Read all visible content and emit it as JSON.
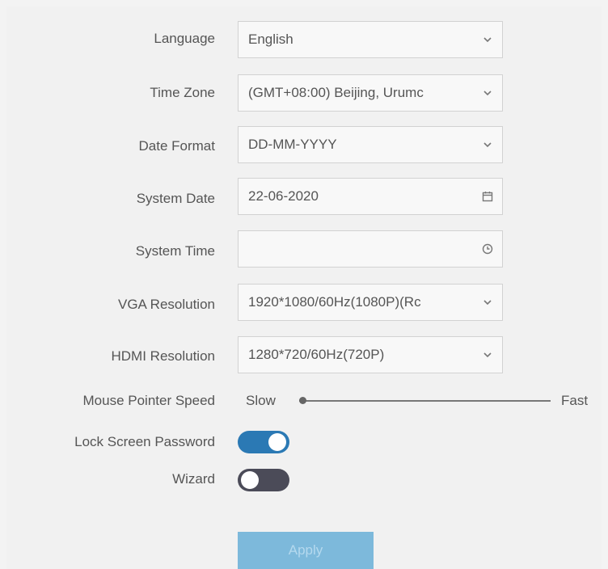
{
  "form": {
    "language": {
      "label": "Language",
      "value": "English",
      "icon": "chevron-down-icon"
    },
    "time_zone": {
      "label": "Time Zone",
      "value": "(GMT+08:00) Beijing, Urumc",
      "icon": "chevron-down-icon"
    },
    "date_format": {
      "label": "Date Format",
      "value": "DD-MM-YYYY",
      "icon": "chevron-down-icon"
    },
    "system_date": {
      "label": "System Date",
      "value": "22-06-2020",
      "icon": "calendar-icon"
    },
    "system_time": {
      "label": "System Time",
      "value": "",
      "icon": "clock-icon"
    },
    "vga_resolution": {
      "label": "VGA Resolution",
      "value": "1920*1080/60Hz(1080P)(Rc",
      "icon": "chevron-down-icon"
    },
    "hdmi_resolution": {
      "label": "HDMI Resolution",
      "value": "1280*720/60Hz(720P)",
      "icon": "chevron-down-icon"
    },
    "mouse_pointer_speed": {
      "label": "Mouse Pointer Speed",
      "min_label": "Slow",
      "max_label": "Fast",
      "value_fraction": 0.0
    },
    "lock_screen_password": {
      "label": "Lock Screen Password",
      "enabled": true
    },
    "wizard": {
      "label": "Wizard",
      "enabled": false
    }
  },
  "actions": {
    "apply_label": "Apply"
  },
  "colors": {
    "toggle_on": "#2b79b4",
    "toggle_off": "#4b4b58",
    "apply_button": "#7db9db"
  }
}
